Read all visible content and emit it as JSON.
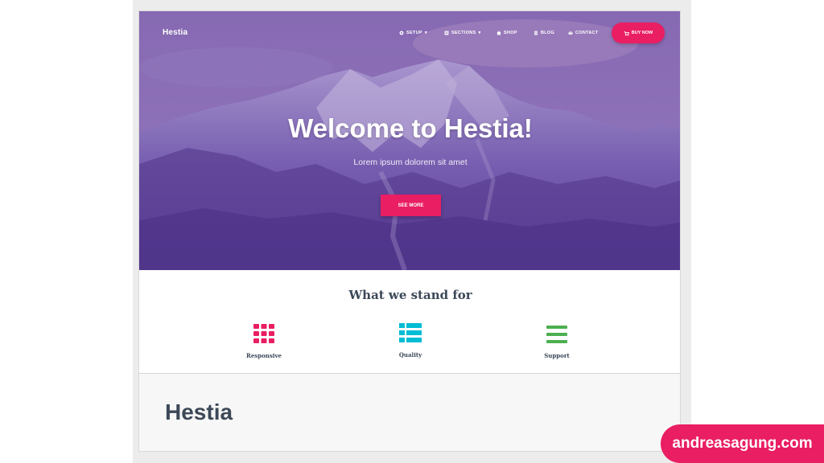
{
  "site": {
    "brand": "Hestia",
    "nav": [
      {
        "label": "SETUP",
        "icon": "gear-icon",
        "dropdown": true
      },
      {
        "label": "SECTIONS",
        "icon": "sections-icon",
        "dropdown": true
      },
      {
        "label": "SHOP",
        "icon": "shop-icon",
        "dropdown": false
      },
      {
        "label": "BLOG",
        "icon": "blog-icon",
        "dropdown": false
      },
      {
        "label": "CONTACT",
        "icon": "mail-icon",
        "dropdown": false
      }
    ],
    "buy_button": {
      "label": "BUY NOW",
      "icon": "cart-icon"
    }
  },
  "hero": {
    "title": "Welcome to Hestia!",
    "subtitle": "Lorem ipsum dolorem sit amet",
    "cta_label": "SEE MORE"
  },
  "features": {
    "title": "What we stand for",
    "items": [
      {
        "label": "Responsive",
        "icon": "grid-icon",
        "color": "#e91e63"
      },
      {
        "label": "Quality",
        "icon": "list-icon",
        "color": "#00bcd4"
      },
      {
        "label": "Support",
        "icon": "menu-icon",
        "color": "#4caf50"
      }
    ]
  },
  "bottom": {
    "title": "Hestia"
  },
  "watermark": {
    "text": "andreasagung.com"
  },
  "colors": {
    "accent": "#e91e63",
    "hero": "#6a4c9e",
    "heading": "#3c4858"
  }
}
